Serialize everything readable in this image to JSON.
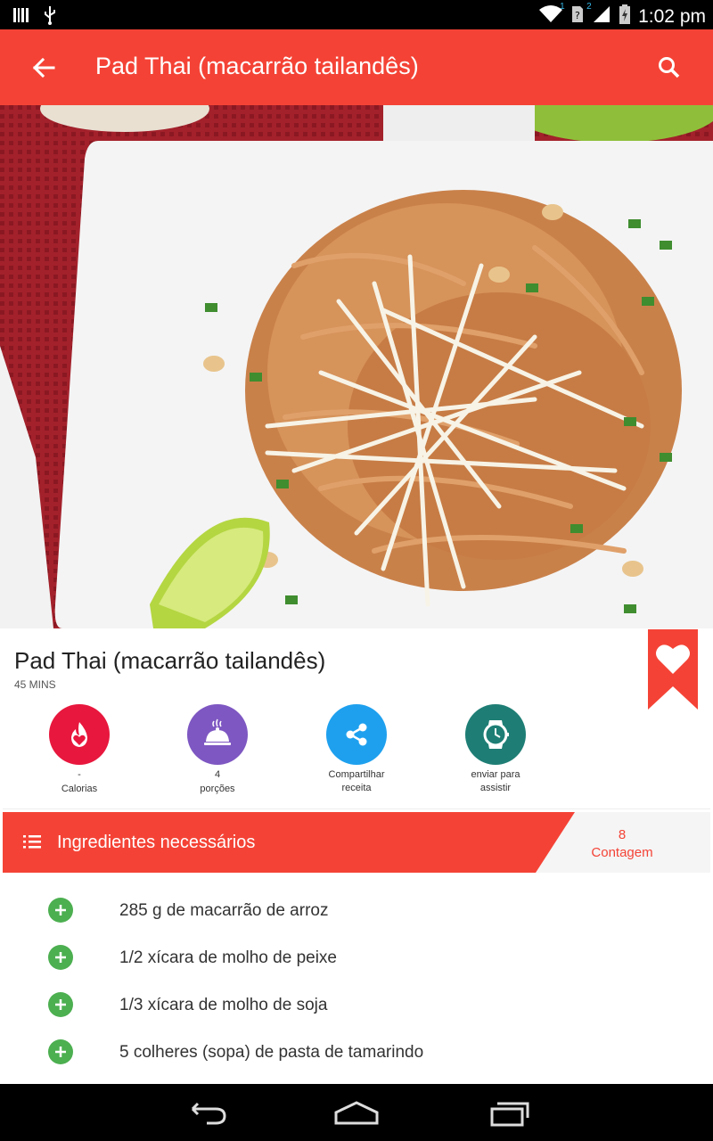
{
  "status_bar": {
    "time": "1:02 pm",
    "sim1": "1",
    "sim2": "2",
    "icons": [
      "barcode-icon",
      "usb-icon",
      "wifi-icon",
      "no-sim-icon",
      "signal-icon",
      "battery-charging-icon"
    ]
  },
  "app_bar": {
    "title": "Pad Thai (macarrão tailandês)",
    "back_icon": "arrow-back-icon",
    "search_icon": "search-icon"
  },
  "hero": {
    "alt": "Pad Thai dish photo"
  },
  "recipe": {
    "title": "Pad Thai (macarrão tailandês)",
    "time": "45 MINS"
  },
  "actions": [
    {
      "line1": "-",
      "line2": "Calorias",
      "color": "#e8173d",
      "icon": "calories-flame-icon"
    },
    {
      "line1": "4",
      "line2": "porções",
      "color": "#7e57c2",
      "icon": "serving-cloche-icon"
    },
    {
      "line1": "Compartilhar",
      "line2": "receita",
      "color": "#1ea0ee",
      "icon": "share-icon"
    },
    {
      "line1": "enviar para",
      "line2": "assistir",
      "color": "#1e7e75",
      "icon": "watch-icon"
    }
  ],
  "ingredients_header": {
    "title": "Ingredientes necessários",
    "count_value": "8",
    "count_label": "Contagem"
  },
  "ingredients": [
    "285 g de macarrão de arroz",
    "1/2 xícara de molho de peixe",
    "1/3 xícara de molho de soja",
    "5 colheres (sopa) de pasta de tamarindo"
  ],
  "colors": {
    "primary": "#f44336",
    "accent_green": "#4caf50"
  },
  "nav": {
    "back_icon": "nav-back-icon",
    "home_icon": "nav-home-icon",
    "recents_icon": "nav-recents-icon"
  }
}
